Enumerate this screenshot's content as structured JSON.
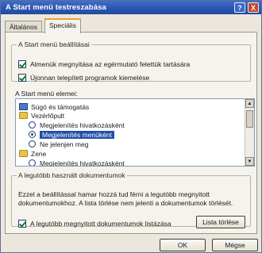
{
  "window": {
    "title": "A Start menü testreszabása",
    "help_label": "?",
    "close_label": "X"
  },
  "tabs": [
    {
      "label": "Általános"
    },
    {
      "label": "Speciális"
    }
  ],
  "start_menu_settings": {
    "legend": "A Start menü beállításai",
    "options": [
      {
        "label": "Almenük megnyitása az egérmutató felettük tartására",
        "checked": true
      },
      {
        "label": "Újonnan telepített programok kiemelése",
        "checked": true
      }
    ]
  },
  "start_menu_items": {
    "caption": "A Start menü elemei:",
    "items": [
      {
        "label": "Súgó és támogatás",
        "icon": "help-icon"
      },
      {
        "label": "Vezérlőpult",
        "icon": "folder-icon"
      },
      {
        "label": "Megjelenítés hivatkozásként",
        "selected": false
      },
      {
        "label": "Megjelenítés menüként",
        "selected": true
      },
      {
        "label": "Ne jelenjen meg",
        "selected": false
      },
      {
        "label": "Zene",
        "icon": "folder-icon"
      },
      {
        "label": "Megjelenítés hivatkozásként",
        "selected": false
      }
    ]
  },
  "recent_documents": {
    "legend": "A legutóbb használt dokumentumok",
    "description": "Ezzel a beállítással hamar hozzá tud férni a legutóbb megnyitott dokumentumokhoz. A lista törlése nem jelenti a dokumentumok törlését.",
    "list_option": {
      "label": "A legutóbb megnyitott dokumentumok listázása",
      "checked": true
    },
    "clear_button": "Lista törlése"
  },
  "footer": {
    "ok_label": "OK",
    "cancel_label": "Mégse"
  }
}
